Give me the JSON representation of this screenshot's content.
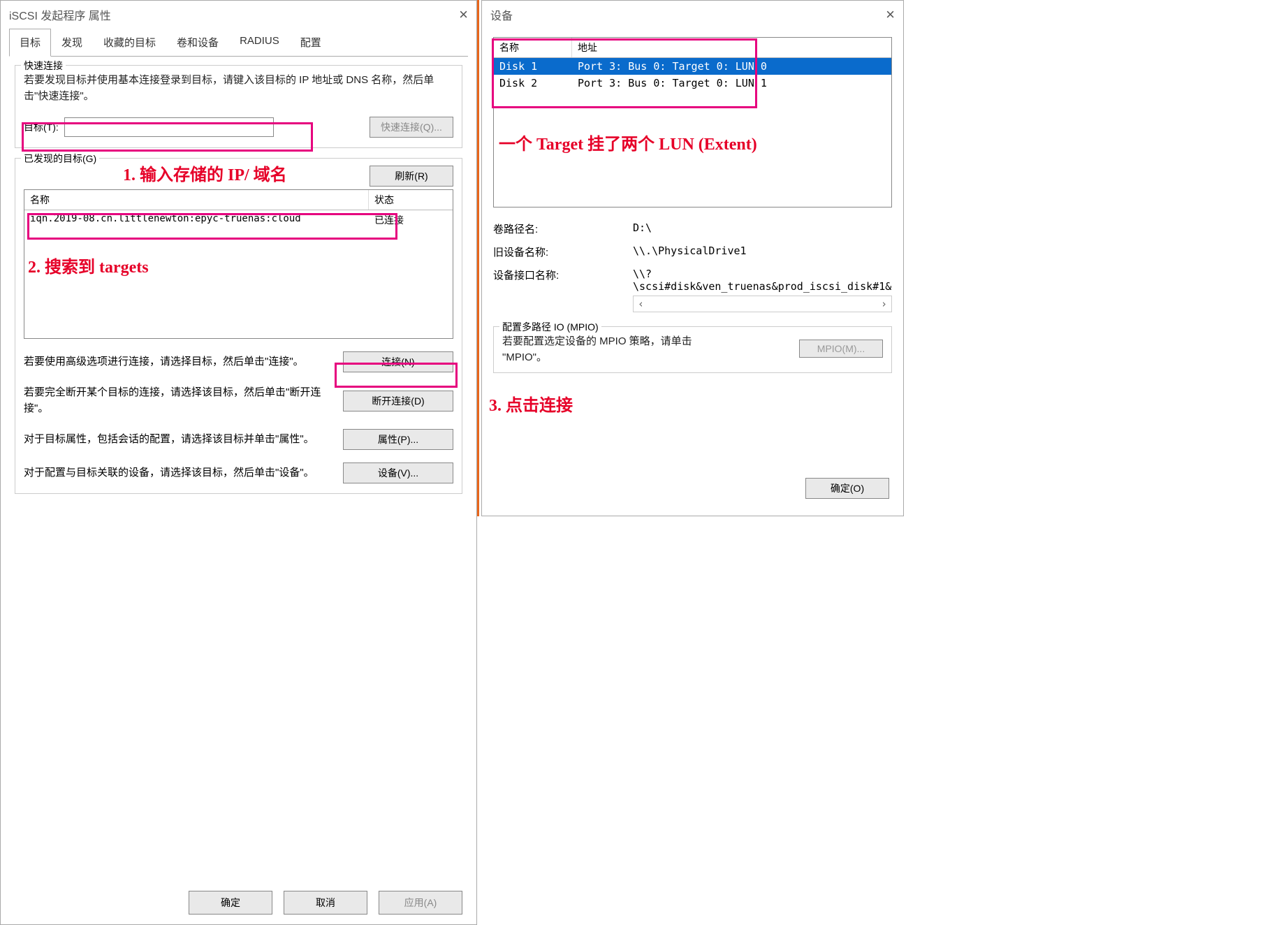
{
  "left": {
    "title": "iSCSI 发起程序 属性",
    "tabs": [
      "目标",
      "发现",
      "收藏的目标",
      "卷和设备",
      "RADIUS",
      "配置"
    ],
    "quick": {
      "group_title": "快速连接",
      "desc": "若要发现目标并使用基本连接登录到目标，请键入该目标的 IP 地址或 DNS 名称，然后单击\"快速连接\"。",
      "target_label": "目标(T):",
      "target_value": "",
      "quick_btn": "快速连接(Q)..."
    },
    "discovered": {
      "group_title": "已发现的目标(G)",
      "refresh_btn": "刷新(R)",
      "col_name": "名称",
      "col_status": "状态",
      "rows": [
        {
          "name": "iqn.2019-08.cn.littlenewton:epyc-truenas:cloud",
          "status": "已连接"
        }
      ]
    },
    "actions": {
      "connect_text": "若要使用高级选项进行连接，请选择目标，然后单击\"连接\"。",
      "connect_btn": "连接(N)",
      "disconnect_text": "若要完全断开某个目标的连接，请选择该目标，然后单击\"断开连接\"。",
      "disconnect_btn": "断开连接(D)",
      "props_text": "对于目标属性，包括会话的配置，请选择该目标并单击\"属性\"。",
      "props_btn": "属性(P)...",
      "devices_text": "对于配置与目标关联的设备，请选择该目标，然后单击\"设备\"。",
      "devices_btn": "设备(V)..."
    },
    "bottom": {
      "ok": "确定",
      "cancel": "取消",
      "apply": "应用(A)"
    }
  },
  "right": {
    "title": "设备",
    "col_name": "名称",
    "col_addr": "地址",
    "rows": [
      {
        "name": "Disk 1",
        "addr": "Port 3: Bus 0: Target 0: LUN 0"
      },
      {
        "name": "Disk 2",
        "addr": "Port 3: Bus 0: Target 0: LUN 1"
      }
    ],
    "vol_label": "卷路径名:",
    "vol_value": "D:\\",
    "old_label": "旧设备名称:",
    "old_value": "\\\\.\\PhysicalDrive1",
    "intf_label": "设备接口名称:",
    "intf_value": "\\\\?\\scsi#disk&ven_truenas&prod_iscsi_disk#1&",
    "mpio": {
      "group_title": "配置多路径 IO (MPIO)",
      "text": "若要配置选定设备的 MPIO 策略，请单击 \"MPIO\"。",
      "btn": "MPIO(M)..."
    },
    "ok": "确定(O)"
  },
  "anno": {
    "a1": "1. 输入存储的 IP/ 域名",
    "a2": "2. 搜索到 targets",
    "a3": "3. 点击连接",
    "a4": "一个 Target 挂了两个 LUN (Extent)"
  }
}
